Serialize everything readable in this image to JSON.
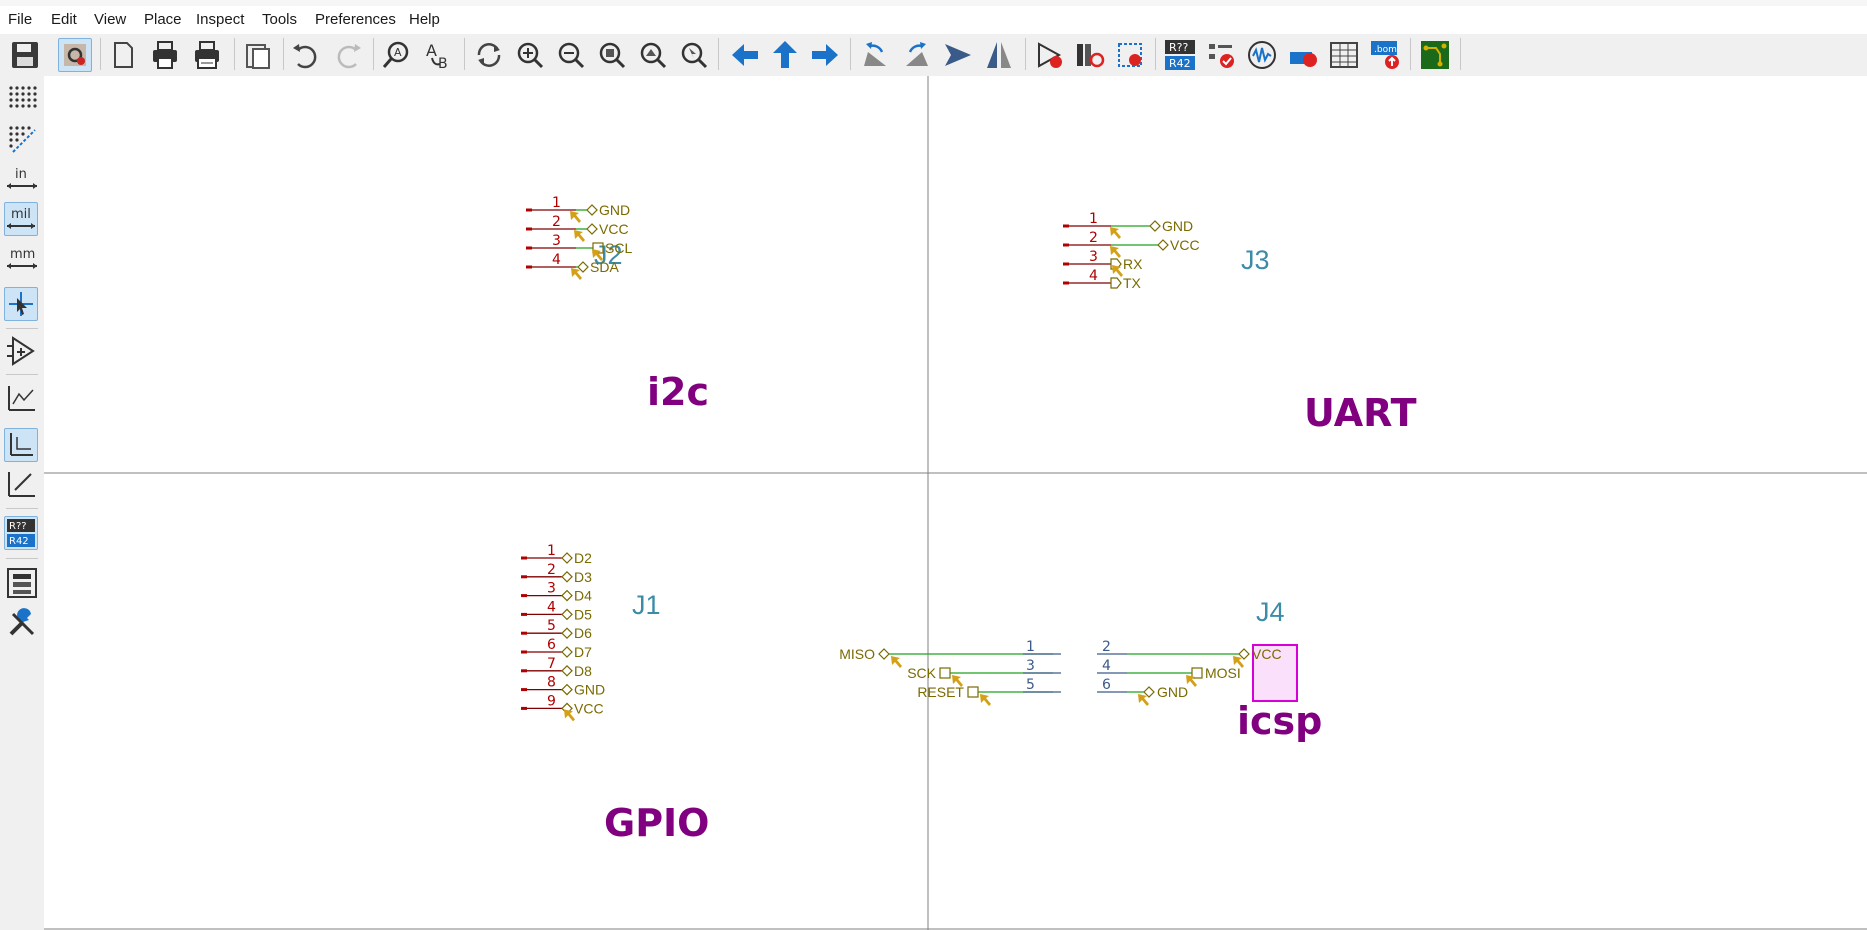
{
  "menu": [
    "File",
    "Edit",
    "View",
    "Place",
    "Inspect",
    "Tools",
    "Preferences",
    "Help"
  ],
  "toolbar_icons": [
    "save-icon",
    "schematic-setup-icon",
    "page-settings-icon",
    "print-icon",
    "plot-icon",
    "paste-icon",
    "undo-icon",
    "redo-icon",
    "find-icon",
    "find-replace-icon",
    "refresh-icon",
    "zoom-in-icon",
    "zoom-out-icon",
    "zoom-fit-icon",
    "zoom-objects-icon",
    "zoom-selection-icon",
    "navigate-back-icon",
    "navigate-up-icon",
    "navigate-forward-icon",
    "rotate-ccw-icon",
    "rotate-cw-icon",
    "mirror-vertical-icon",
    "mirror-horizontal-icon",
    "symbol-editor-icon",
    "symbol-browser-icon",
    "footprint-assign-icon",
    "annotate-icon",
    "erc-icon",
    "simulator-icon",
    "bus-alias-icon",
    "symbol-fields-table-icon",
    "bom-icon",
    "pcb-editor-icon"
  ],
  "left_icons": [
    "grid-dots-icon",
    "grid-overlay-icon",
    "units-inches-icon",
    "units-mils-icon",
    "units-mm-icon",
    "cursor-icon",
    "hidden-pins-icon",
    "wire-free-angle-icon",
    "wire-90-icon",
    "wire-45-icon",
    "annotation-icon",
    "hierarchy-navigator-icon",
    "properties-icon"
  ],
  "units": {
    "in": "in",
    "mil": "mil",
    "mm": "mm"
  },
  "annotate_icon_text": {
    "top": "R??",
    "bottom": "R42"
  },
  "colors": {
    "reference": "#3c8ca8",
    "pin_number": "#b00000",
    "pin": "#800000",
    "wire": "#1fa51f",
    "net_label": "#7a6a00",
    "title": "#800080",
    "marker": "#d4a017",
    "body": "#d800d8"
  },
  "symbols": [
    {
      "ref": "J2",
      "title": "i2c",
      "pins": [
        {
          "num": "1",
          "net": "GND"
        },
        {
          "num": "2",
          "net": "VCC"
        },
        {
          "num": "3",
          "net": "SCL"
        },
        {
          "num": "4",
          "net": "SDA"
        }
      ]
    },
    {
      "ref": "J3",
      "title": "UART",
      "pins": [
        {
          "num": "1",
          "net": "GND"
        },
        {
          "num": "2",
          "net": "VCC"
        },
        {
          "num": "3",
          "net": "RX"
        },
        {
          "num": "4",
          "net": "TX"
        }
      ]
    },
    {
      "ref": "J1",
      "title": "GPIO",
      "pins": [
        {
          "num": "1",
          "net": "D2"
        },
        {
          "num": "2",
          "net": "D3"
        },
        {
          "num": "3",
          "net": "D4"
        },
        {
          "num": "4",
          "net": "D5"
        },
        {
          "num": "5",
          "net": "D6"
        },
        {
          "num": "6",
          "net": "D7"
        },
        {
          "num": "7",
          "net": "D8"
        },
        {
          "num": "8",
          "net": "GND"
        },
        {
          "num": "9",
          "net": "VCC"
        }
      ]
    },
    {
      "ref": "J4",
      "title": "icsp",
      "pins": [
        {
          "num": "1",
          "net": "MISO"
        },
        {
          "num": "2",
          "net": "VCC"
        },
        {
          "num": "3",
          "net": "SCK"
        },
        {
          "num": "4",
          "net": "MOSI"
        },
        {
          "num": "5",
          "net": "RESET"
        },
        {
          "num": "6",
          "net": "GND"
        }
      ]
    }
  ]
}
